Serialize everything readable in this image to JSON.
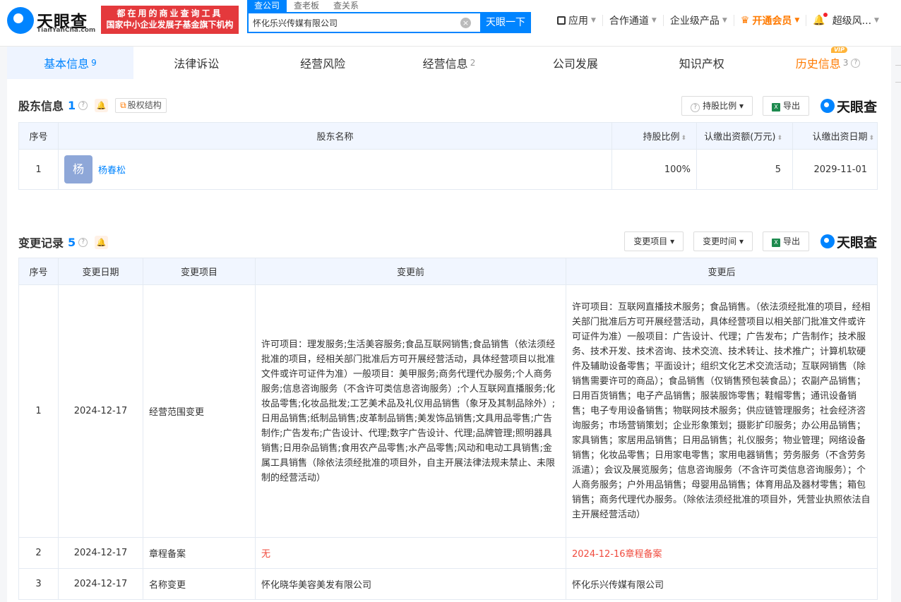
{
  "header": {
    "logo_text": "天眼查",
    "logo_sub": "TianYanCha.com",
    "slogan_line1": "都在用的商业查询工具",
    "slogan_line2": "国家中小企业发展子基金旗下机构",
    "search_tabs": [
      "查公司",
      "查老板",
      "查关系"
    ],
    "search_value": "怀化乐兴传媒有限公司",
    "search_button": "天眼一下",
    "nav": {
      "apps": "应用",
      "partner": "合作通道",
      "enterprise": "企业级产品",
      "vip": "开通会员",
      "user": "超级风..."
    }
  },
  "tabs": [
    {
      "label": "基本信息",
      "count": "9"
    },
    {
      "label": "法律诉讼",
      "count": ""
    },
    {
      "label": "经营风险",
      "count": ""
    },
    {
      "label": "经营信息",
      "count": "2"
    },
    {
      "label": "公司发展",
      "count": ""
    },
    {
      "label": "知识产权",
      "count": ""
    },
    {
      "label": "历史信息",
      "count": "3",
      "badge": "VIP"
    }
  ],
  "shareholders": {
    "title": "股东信息",
    "count": "1",
    "equity_button": "股权结构",
    "ratio_filter": "持股比例",
    "export": "导出",
    "brand": "天眼查",
    "columns": [
      "序号",
      "股东名称",
      "持股比例",
      "认缴出资额(万元)",
      "认缴出资日期"
    ],
    "rows": [
      {
        "index": "1",
        "avatar": "杨",
        "name": "杨春松",
        "ratio": "100%",
        "amount": "5",
        "date": "2029-11-01"
      }
    ]
  },
  "changes": {
    "title": "变更记录",
    "count": "5",
    "item_filter": "变更项目",
    "time_filter": "变更时间",
    "export": "导出",
    "brand": "天眼查",
    "columns": [
      "序号",
      "变更日期",
      "变更项目",
      "变更前",
      "变更后"
    ],
    "rows": [
      {
        "index": "1",
        "date": "2024-12-17",
        "item": "经营范围变更",
        "before": "许可项目：理发服务;生活美容服务;食品互联网销售;食品销售（依法须经批准的项目，经相关部门批准后方可开展经营活动，具体经营项目以批准文件或许可证件为准）一般项目：美甲服务;商务代理代办服务;个人商务服务;信息咨询服务（不含许可类信息咨询服务）;个人互联网直播服务;化妆品零售;化妆品批发;工艺美术品及礼仪用品销售（象牙及其制品除外）;日用品销售;纸制品销售;皮革制品销售;美发饰品销售;文具用品零售;广告制作;广告发布;广告设计、代理;数字广告设计、代理;品牌管理;照明器具销售;日用杂品销售;食用农产品零售;水产品零售;风动和电动工具销售;金属工具销售（除依法须经批准的项目外，自主开展法律法规未禁止、未限制的经营活动）",
        "after": "许可项目：互联网直播技术服务；食品销售。（依法须经批准的项目，经相关部门批准后方可开展经营活动，具体经营项目以相关部门批准文件或许可证件为准）一般项目：广告设计、代理；广告发布；广告制作；技术服务、技术开发、技术咨询、技术交流、技术转让、技术推广；计算机软硬件及辅助设备零售；平面设计；组织文化艺术交流活动；互联网销售（除销售需要许可的商品）；食品销售（仅销售预包装食品）；农副产品销售；日用百货销售；电子产品销售；服装服饰零售；鞋帽零售；通讯设备销售；电子专用设备销售；物联网技术服务；供应链管理服务；社会经济咨询服务；市场营销策划；企业形象策划；摄影扩印服务；办公用品销售；家具销售；家居用品销售；日用品销售；礼仪服务；物业管理；网络设备销售；化妆品零售；日用家电零售；家用电器销售；劳务服务（不含劳务派遣）；会议及展览服务；信息咨询服务（不含许可类信息咨询服务）；个人商务服务；户外用品销售；母婴用品销售；体育用品及器材零售；箱包销售；商务代理代办服务。（除依法须经批准的项目外，凭营业执照依法自主开展经营活动）"
      },
      {
        "index": "2",
        "date": "2024-12-17",
        "item": "章程备案",
        "before": "无",
        "after": "2024-12-16章程备案"
      },
      {
        "index": "3",
        "date": "2024-12-17",
        "item": "名称变更",
        "before": "怀化晓华美容美发有限公司",
        "after": "怀化乐兴传媒有限公司"
      }
    ]
  },
  "colors": {
    "accent": "#0084ff",
    "highlight": "#f04b3e",
    "vip": "#ff7a00"
  }
}
